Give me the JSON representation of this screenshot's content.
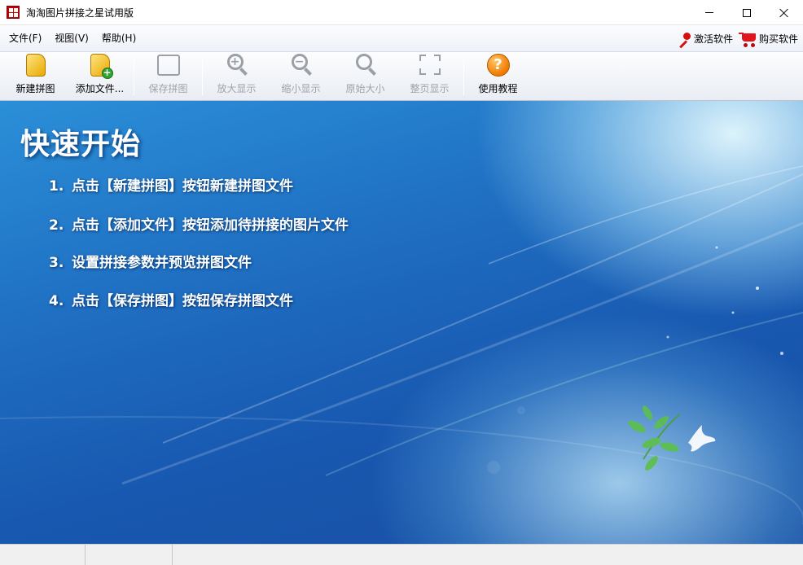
{
  "window": {
    "title": "淘淘图片拼接之星试用版"
  },
  "menu": {
    "items": [
      {
        "label": "文件(F)"
      },
      {
        "label": "视图(V)"
      },
      {
        "label": "帮助(H)"
      }
    ],
    "activate_label": "激活软件",
    "buy_label": "购买软件"
  },
  "toolbar": {
    "buttons": [
      {
        "label": "新建拼图",
        "icon": "new-puzzle-icon",
        "enabled": true
      },
      {
        "label": "添加文件...",
        "icon": "add-file-icon",
        "enabled": true
      },
      {
        "label": "保存拼图",
        "icon": "save-icon",
        "enabled": false
      },
      {
        "label": "放大显示",
        "icon": "zoom-in-icon",
        "enabled": false
      },
      {
        "label": "缩小显示",
        "icon": "zoom-out-icon",
        "enabled": false
      },
      {
        "label": "原始大小",
        "icon": "actual-size-icon",
        "enabled": false
      },
      {
        "label": "整页显示",
        "icon": "fit-page-icon",
        "enabled": false
      },
      {
        "label": "使用教程",
        "icon": "help-icon",
        "enabled": true
      }
    ]
  },
  "quickstart": {
    "title": "快速开始",
    "steps": [
      {
        "num": "1.",
        "text": "点击【新建拼图】按钮新建拼图文件"
      },
      {
        "num": "2.",
        "text": "点击【添加文件】按钮添加待拼接的图片文件"
      },
      {
        "num": "3.",
        "text": "设置拼接参数并预览拼图文件"
      },
      {
        "num": "4.",
        "text": "点击【保存拼图】按钮保存拼图文件"
      }
    ]
  },
  "colors": {
    "accent_red": "#d61010",
    "background_blue": "#1f6fc2"
  }
}
